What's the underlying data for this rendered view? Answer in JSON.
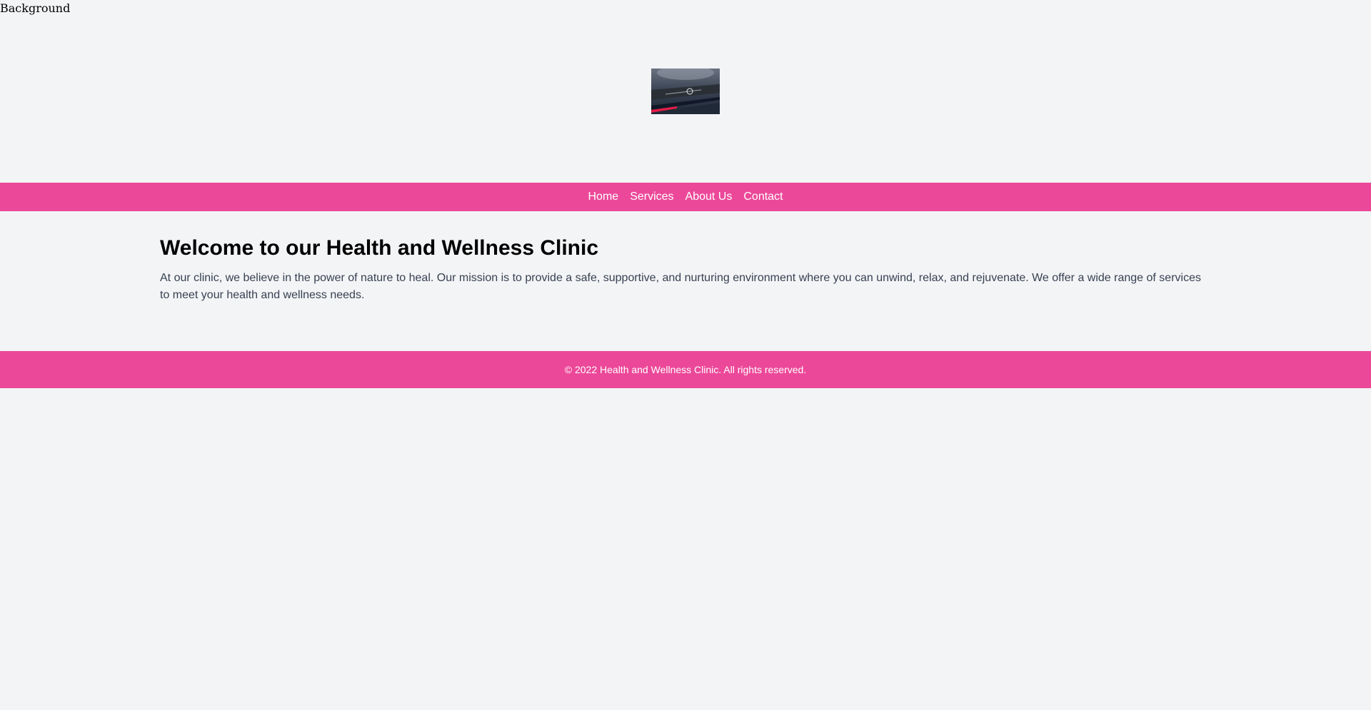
{
  "background_label": "Background",
  "logo": {
    "alt": "clinic logo photo"
  },
  "nav": {
    "items": [
      {
        "label": "Home"
      },
      {
        "label": "Services"
      },
      {
        "label": "About Us"
      },
      {
        "label": "Contact"
      }
    ]
  },
  "main": {
    "heading": "Welcome to our Health and Wellness Clinic",
    "body": "At our clinic, we believe in the power of nature to heal. Our mission is to provide a safe, supportive, and nurturing environment where you can unwind, relax, and rejuvenate. We offer a wide range of services to meet your health and wellness needs."
  },
  "footer": {
    "text": "© 2022 Health and Wellness Clinic. All rights reserved."
  },
  "colors": {
    "page_background": "#f3f4f6",
    "accent_pink": "#ec4899",
    "heading_text": "#000000",
    "body_text": "#374151",
    "nav_text": "#ffffff"
  }
}
